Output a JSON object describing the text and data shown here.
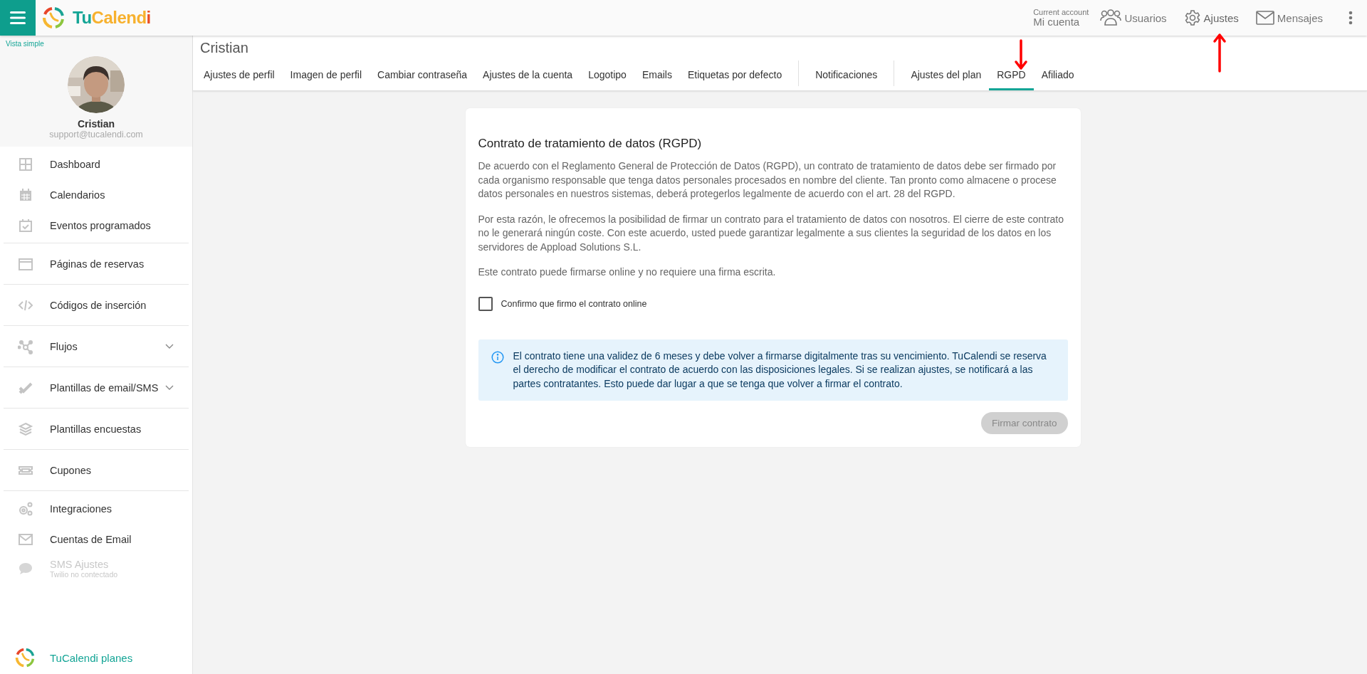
{
  "topbar": {
    "logo": [
      "Tu",
      "Calend",
      "i"
    ],
    "account": {
      "caption": "Current account",
      "name": "Mi cuenta"
    },
    "links": [
      {
        "label": "Usuarios",
        "selected": false
      },
      {
        "label": "Ajustes",
        "selected": true
      },
      {
        "label": "Mensajes",
        "selected": false
      }
    ]
  },
  "sidebar": {
    "view_toggle": "Vista simple",
    "profile": {
      "name": "Cristian",
      "email": "support@tucalendi.com"
    },
    "groups": [
      {
        "items": [
          {
            "label": "Dashboard",
            "expandable": false,
            "disabled": false
          },
          {
            "label": "Calendarios",
            "expandable": false,
            "disabled": false
          },
          {
            "label": "Eventos programados",
            "expandable": false,
            "disabled": false
          }
        ]
      },
      {
        "items": [
          {
            "label": "Páginas de reservas",
            "expandable": false,
            "disabled": false
          }
        ]
      },
      {
        "items": [
          {
            "label": "Códigos de inserción",
            "expandable": false,
            "disabled": false
          }
        ]
      },
      {
        "items": [
          {
            "label": "Flujos",
            "expandable": true,
            "disabled": false
          }
        ]
      },
      {
        "items": [
          {
            "label": "Plantillas de email/SMS",
            "expandable": true,
            "disabled": false
          }
        ]
      },
      {
        "items": [
          {
            "label": "Plantillas encuestas",
            "expandable": false,
            "disabled": false
          }
        ]
      },
      {
        "items": [
          {
            "label": "Cupones",
            "expandable": false,
            "disabled": false
          }
        ]
      },
      {
        "items": [
          {
            "label": "Integraciones",
            "expandable": false,
            "disabled": false
          },
          {
            "label": "Cuentas de Email",
            "expandable": false,
            "disabled": false
          },
          {
            "label": "SMS Ajustes",
            "subtitle": "Twilio no contectado",
            "expandable": false,
            "disabled": true
          }
        ]
      }
    ],
    "footer": "TuCalendi planes"
  },
  "page": {
    "title": "Cristian",
    "tab_groups": [
      {
        "tabs": [
          {
            "label": "Ajustes de perfil",
            "selected": false
          },
          {
            "label": "Imagen de perfil",
            "selected": false
          },
          {
            "label": "Cambiar contraseña",
            "selected": false
          },
          {
            "label": "Ajustes de la cuenta",
            "selected": false
          },
          {
            "label": "Logotipo",
            "selected": false
          },
          {
            "label": "Emails",
            "selected": false
          },
          {
            "label": "Etiquetas por defecto",
            "selected": false
          }
        ]
      },
      {
        "tabs": [
          {
            "label": "Notificaciones",
            "selected": false
          }
        ]
      },
      {
        "tabs": [
          {
            "label": "Ajustes del plan",
            "selected": false
          },
          {
            "label": "RGPD",
            "selected": true
          },
          {
            "label": "Afiliado",
            "selected": false
          }
        ]
      }
    ]
  },
  "card": {
    "title": "Contrato de tratamiento de datos (RGPD)",
    "paragraphs": [
      "De acuerdo con el Reglamento General de Protección de Datos (RGPD), un contrato de tratamiento de datos debe ser firmado por cada organismo responsable que tenga datos personales procesados en nombre del cliente. Tan pronto como almacene o procese datos personales en nuestros sistemas, deberá protegerlos legalmente de acuerdo con el art. 28 del RGPD.",
      "Por esta razón, le ofrecemos la posibilidad de firmar un contrato para el tratamiento de datos con nosotros. El cierre de este contrato no le generará ningún coste. Con este acuerdo, usted puede garantizar legalmente a sus clientes la seguridad de los datos en los servidores de Appload Solutions S.L.",
      "Este contrato puede firmarse online y no requiere una firma escrita."
    ],
    "confirm": {
      "label": "Confirmo que firmo el contrato online",
      "checked": false
    },
    "info": "El contrato tiene una validez de 6 meses y debe volver a firmarse digitalmente tras su vencimiento. TuCalendi se reserva el derecho de modificar el contrato de acuerdo con las disposiciones legales. Si se realizan ajustes, se notificará a las partes contratantes. Esto puede dar lugar a que se tenga que volver a firmar el contrato.",
    "button": {
      "label": "Firmar contrato",
      "disabled": true
    }
  }
}
